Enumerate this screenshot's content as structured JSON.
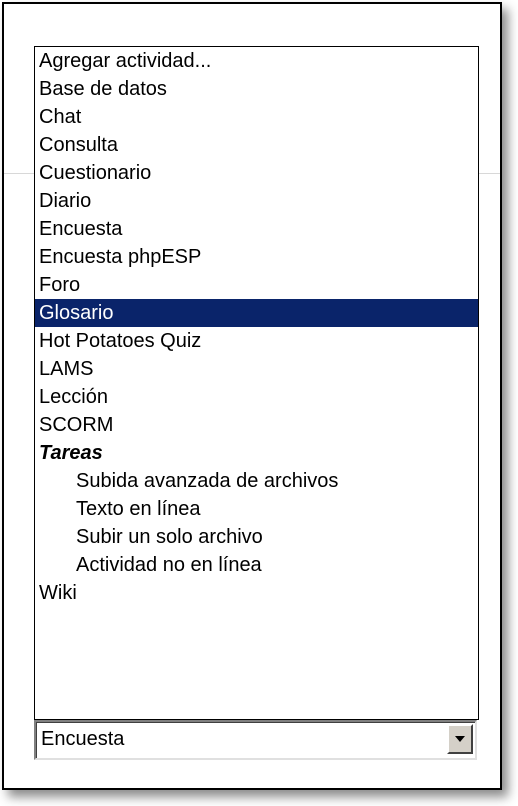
{
  "dropdown": {
    "options": [
      {
        "label": "Agregar actividad...",
        "kind": "option"
      },
      {
        "label": "Base de datos",
        "kind": "option"
      },
      {
        "label": "Chat",
        "kind": "option"
      },
      {
        "label": "Consulta",
        "kind": "option"
      },
      {
        "label": "Cuestionario",
        "kind": "option"
      },
      {
        "label": "Diario",
        "kind": "option"
      },
      {
        "label": "Encuesta",
        "kind": "option"
      },
      {
        "label": "Encuesta phpESP",
        "kind": "option"
      },
      {
        "label": "Foro",
        "kind": "option"
      },
      {
        "label": "Glosario",
        "kind": "option",
        "highlighted": true
      },
      {
        "label": "Hot Potatoes Quiz",
        "kind": "option"
      },
      {
        "label": "LAMS",
        "kind": "option"
      },
      {
        "label": "Lección",
        "kind": "option"
      },
      {
        "label": "SCORM",
        "kind": "option"
      },
      {
        "label": "Tareas",
        "kind": "group"
      },
      {
        "label": "Subida avanzada de archivos",
        "kind": "child"
      },
      {
        "label": "Texto en línea",
        "kind": "child"
      },
      {
        "label": "Subir un solo archivo",
        "kind": "child"
      },
      {
        "label": "Actividad no en línea",
        "kind": "child"
      },
      {
        "label": "Wiki",
        "kind": "option"
      }
    ],
    "selected_value": "Encuesta",
    "highlight_color": "#0a246a",
    "arrow_icon": "chevron-down-icon"
  }
}
